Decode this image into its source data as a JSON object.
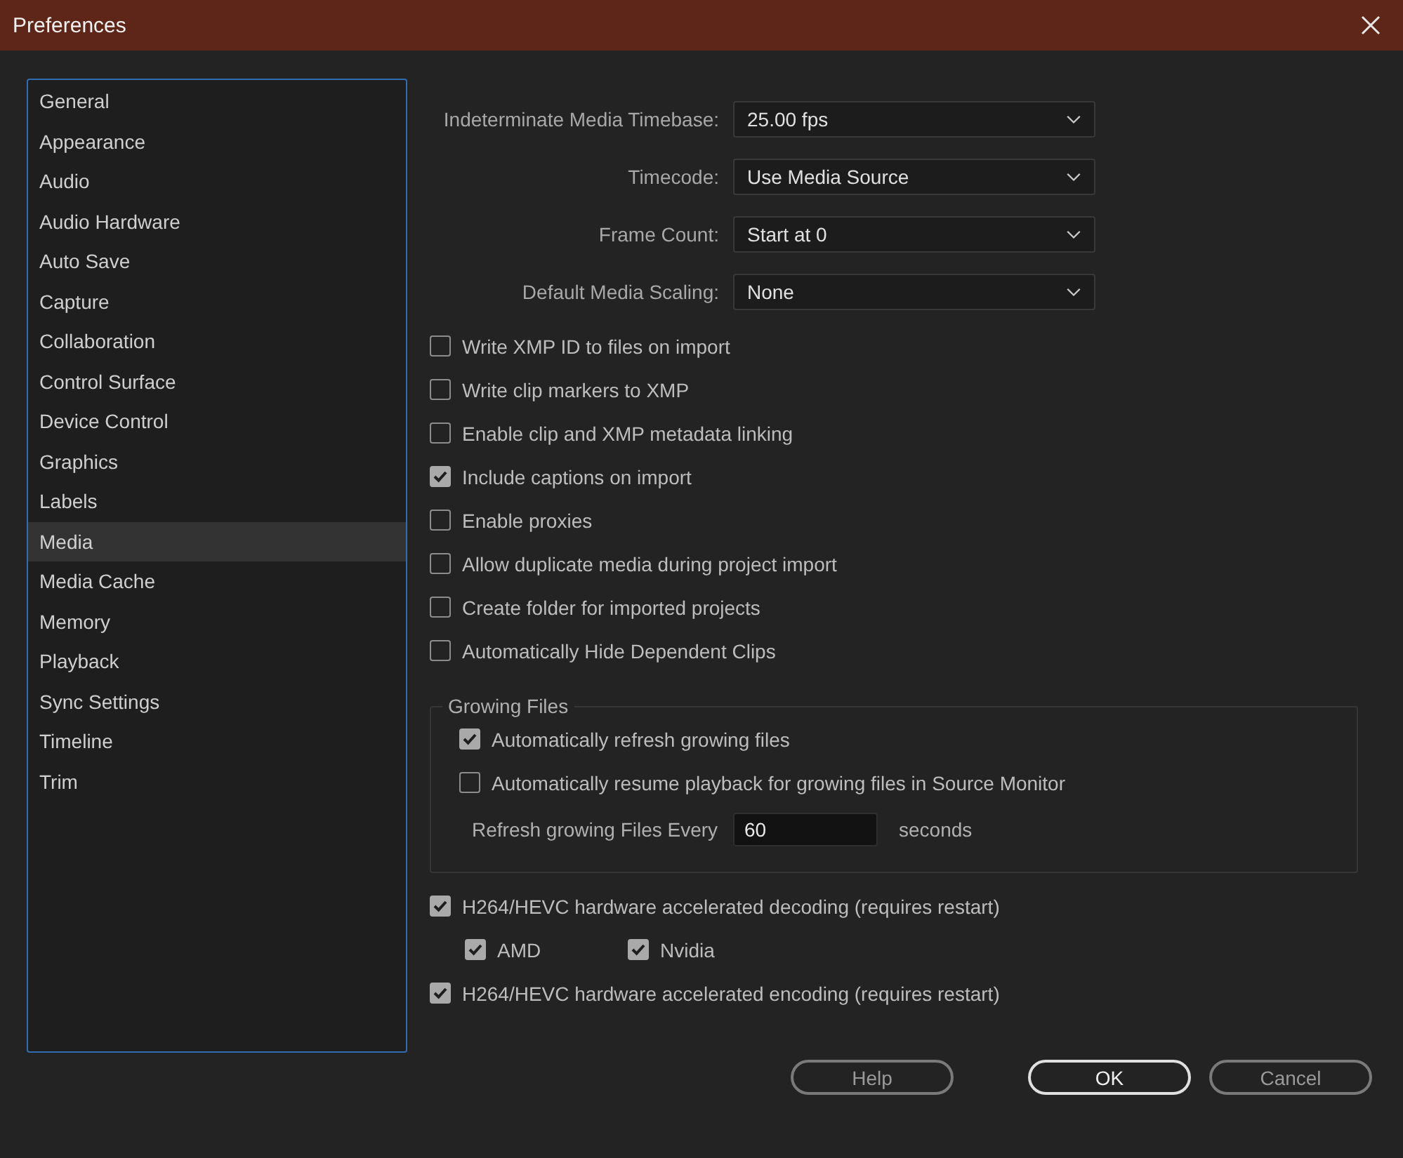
{
  "window": {
    "title": "Preferences"
  },
  "sidebar": {
    "items": [
      {
        "label": "General",
        "selected": false
      },
      {
        "label": "Appearance",
        "selected": false
      },
      {
        "label": "Audio",
        "selected": false
      },
      {
        "label": "Audio Hardware",
        "selected": false
      },
      {
        "label": "Auto Save",
        "selected": false
      },
      {
        "label": "Capture",
        "selected": false
      },
      {
        "label": "Collaboration",
        "selected": false
      },
      {
        "label": "Control Surface",
        "selected": false
      },
      {
        "label": "Device Control",
        "selected": false
      },
      {
        "label": "Graphics",
        "selected": false
      },
      {
        "label": "Labels",
        "selected": false
      },
      {
        "label": "Media",
        "selected": true
      },
      {
        "label": "Media Cache",
        "selected": false
      },
      {
        "label": "Memory",
        "selected": false
      },
      {
        "label": "Playback",
        "selected": false
      },
      {
        "label": "Sync Settings",
        "selected": false
      },
      {
        "label": "Timeline",
        "selected": false
      },
      {
        "label": "Trim",
        "selected": false
      }
    ]
  },
  "dropdowns": [
    {
      "label": "Indeterminate Media Timebase:",
      "value": "25.00 fps"
    },
    {
      "label": "Timecode:",
      "value": "Use Media Source"
    },
    {
      "label": "Frame Count:",
      "value": "Start at 0"
    },
    {
      "label": "Default Media Scaling:",
      "value": "None"
    }
  ],
  "checkboxes": [
    {
      "label": "Write XMP ID to files on import",
      "checked": false
    },
    {
      "label": "Write clip markers to XMP",
      "checked": false
    },
    {
      "label": "Enable clip and XMP metadata linking",
      "checked": false
    },
    {
      "label": "Include captions on import",
      "checked": true
    },
    {
      "label": "Enable proxies",
      "checked": false
    },
    {
      "label": "Allow duplicate media during project import",
      "checked": false
    },
    {
      "label": "Create folder for imported projects",
      "checked": false
    },
    {
      "label": "Automatically Hide Dependent Clips",
      "checked": false
    }
  ],
  "growing_files": {
    "title": "Growing Files",
    "checkboxes": [
      {
        "label": "Automatically refresh growing files",
        "checked": true
      },
      {
        "label": "Automatically resume playback for growing files in Source Monitor",
        "checked": false
      }
    ],
    "refresh_label": "Refresh growing Files Every",
    "refresh_value": "60",
    "unit": "seconds"
  },
  "decoding": {
    "label": "H264/HEVC hardware accelerated decoding (requires restart)",
    "checked": true
  },
  "vendors": [
    {
      "label": "AMD",
      "checked": true
    },
    {
      "label": "Nvidia",
      "checked": true
    }
  ],
  "encoding": {
    "label": "H264/HEVC hardware accelerated encoding (requires restart)",
    "checked": true
  },
  "buttons": [
    {
      "label": "Help",
      "kind": "secondary"
    },
    {
      "label": "OK",
      "kind": "primary"
    },
    {
      "label": "Cancel",
      "kind": "secondary"
    }
  ]
}
